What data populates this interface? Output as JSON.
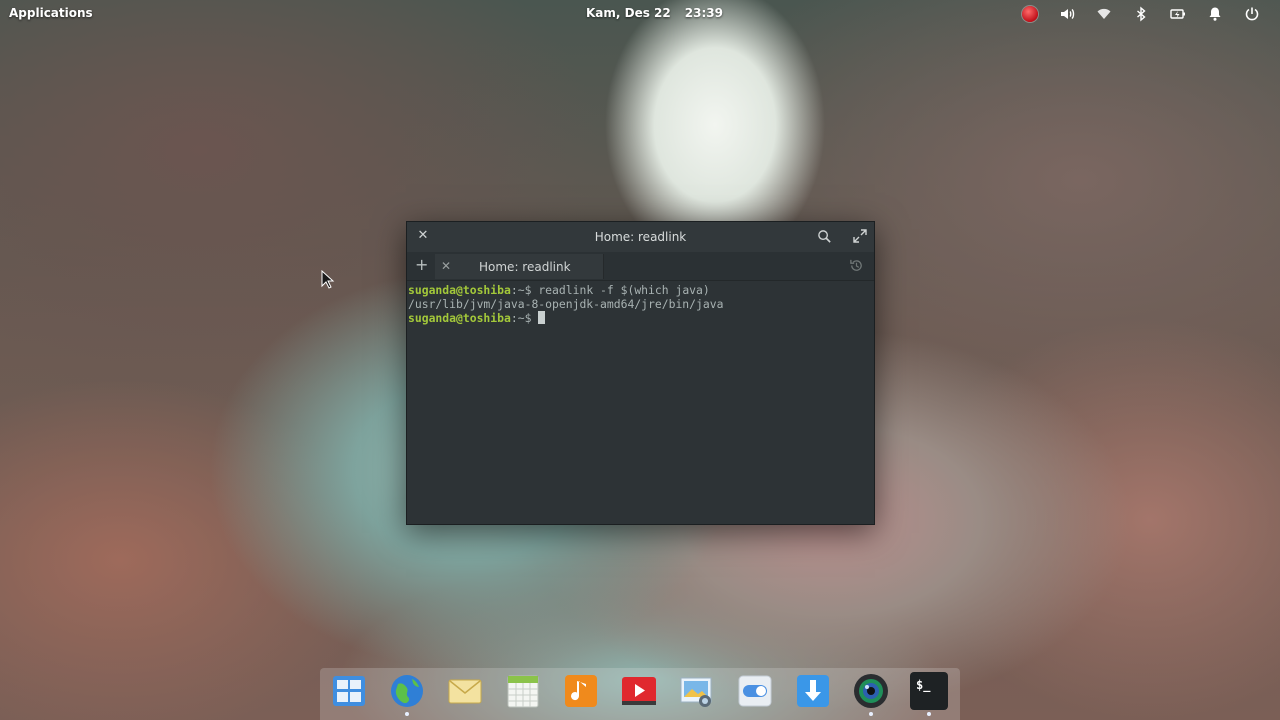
{
  "panel": {
    "applications": "Applications",
    "date": "Kam, Des 22",
    "time": "23:39",
    "indicators": [
      "record-indicator",
      "volume-icon",
      "wifi-icon",
      "bluetooth-icon",
      "battery-icon",
      "notification-bell-icon",
      "power-icon"
    ]
  },
  "terminal": {
    "window_title": "Home: readlink",
    "tab_label": "Home: readlink",
    "lines": [
      {
        "user": "suganda@toshiba",
        "path": ":~$ ",
        "cmd": "readlink -f $(which java)"
      },
      {
        "output": "/usr/lib/jvm/java-8-openjdk-amd64/jre/bin/java"
      },
      {
        "user": "suganda@toshiba",
        "path": ":~$ ",
        "cmd": ""
      }
    ]
  },
  "dock": {
    "items": [
      "multitasking-view-icon",
      "web-browser-icon",
      "mail-icon",
      "calendar-icon",
      "music-icon",
      "videos-icon",
      "photos-icon",
      "system-settings-icon",
      "appcenter-download-icon",
      "camera-icon",
      "terminal-icon"
    ],
    "terminal_glyph": "$_"
  },
  "colors": {
    "prompt_user": "#a3c83a",
    "terminal_bg": "#2d3336"
  }
}
